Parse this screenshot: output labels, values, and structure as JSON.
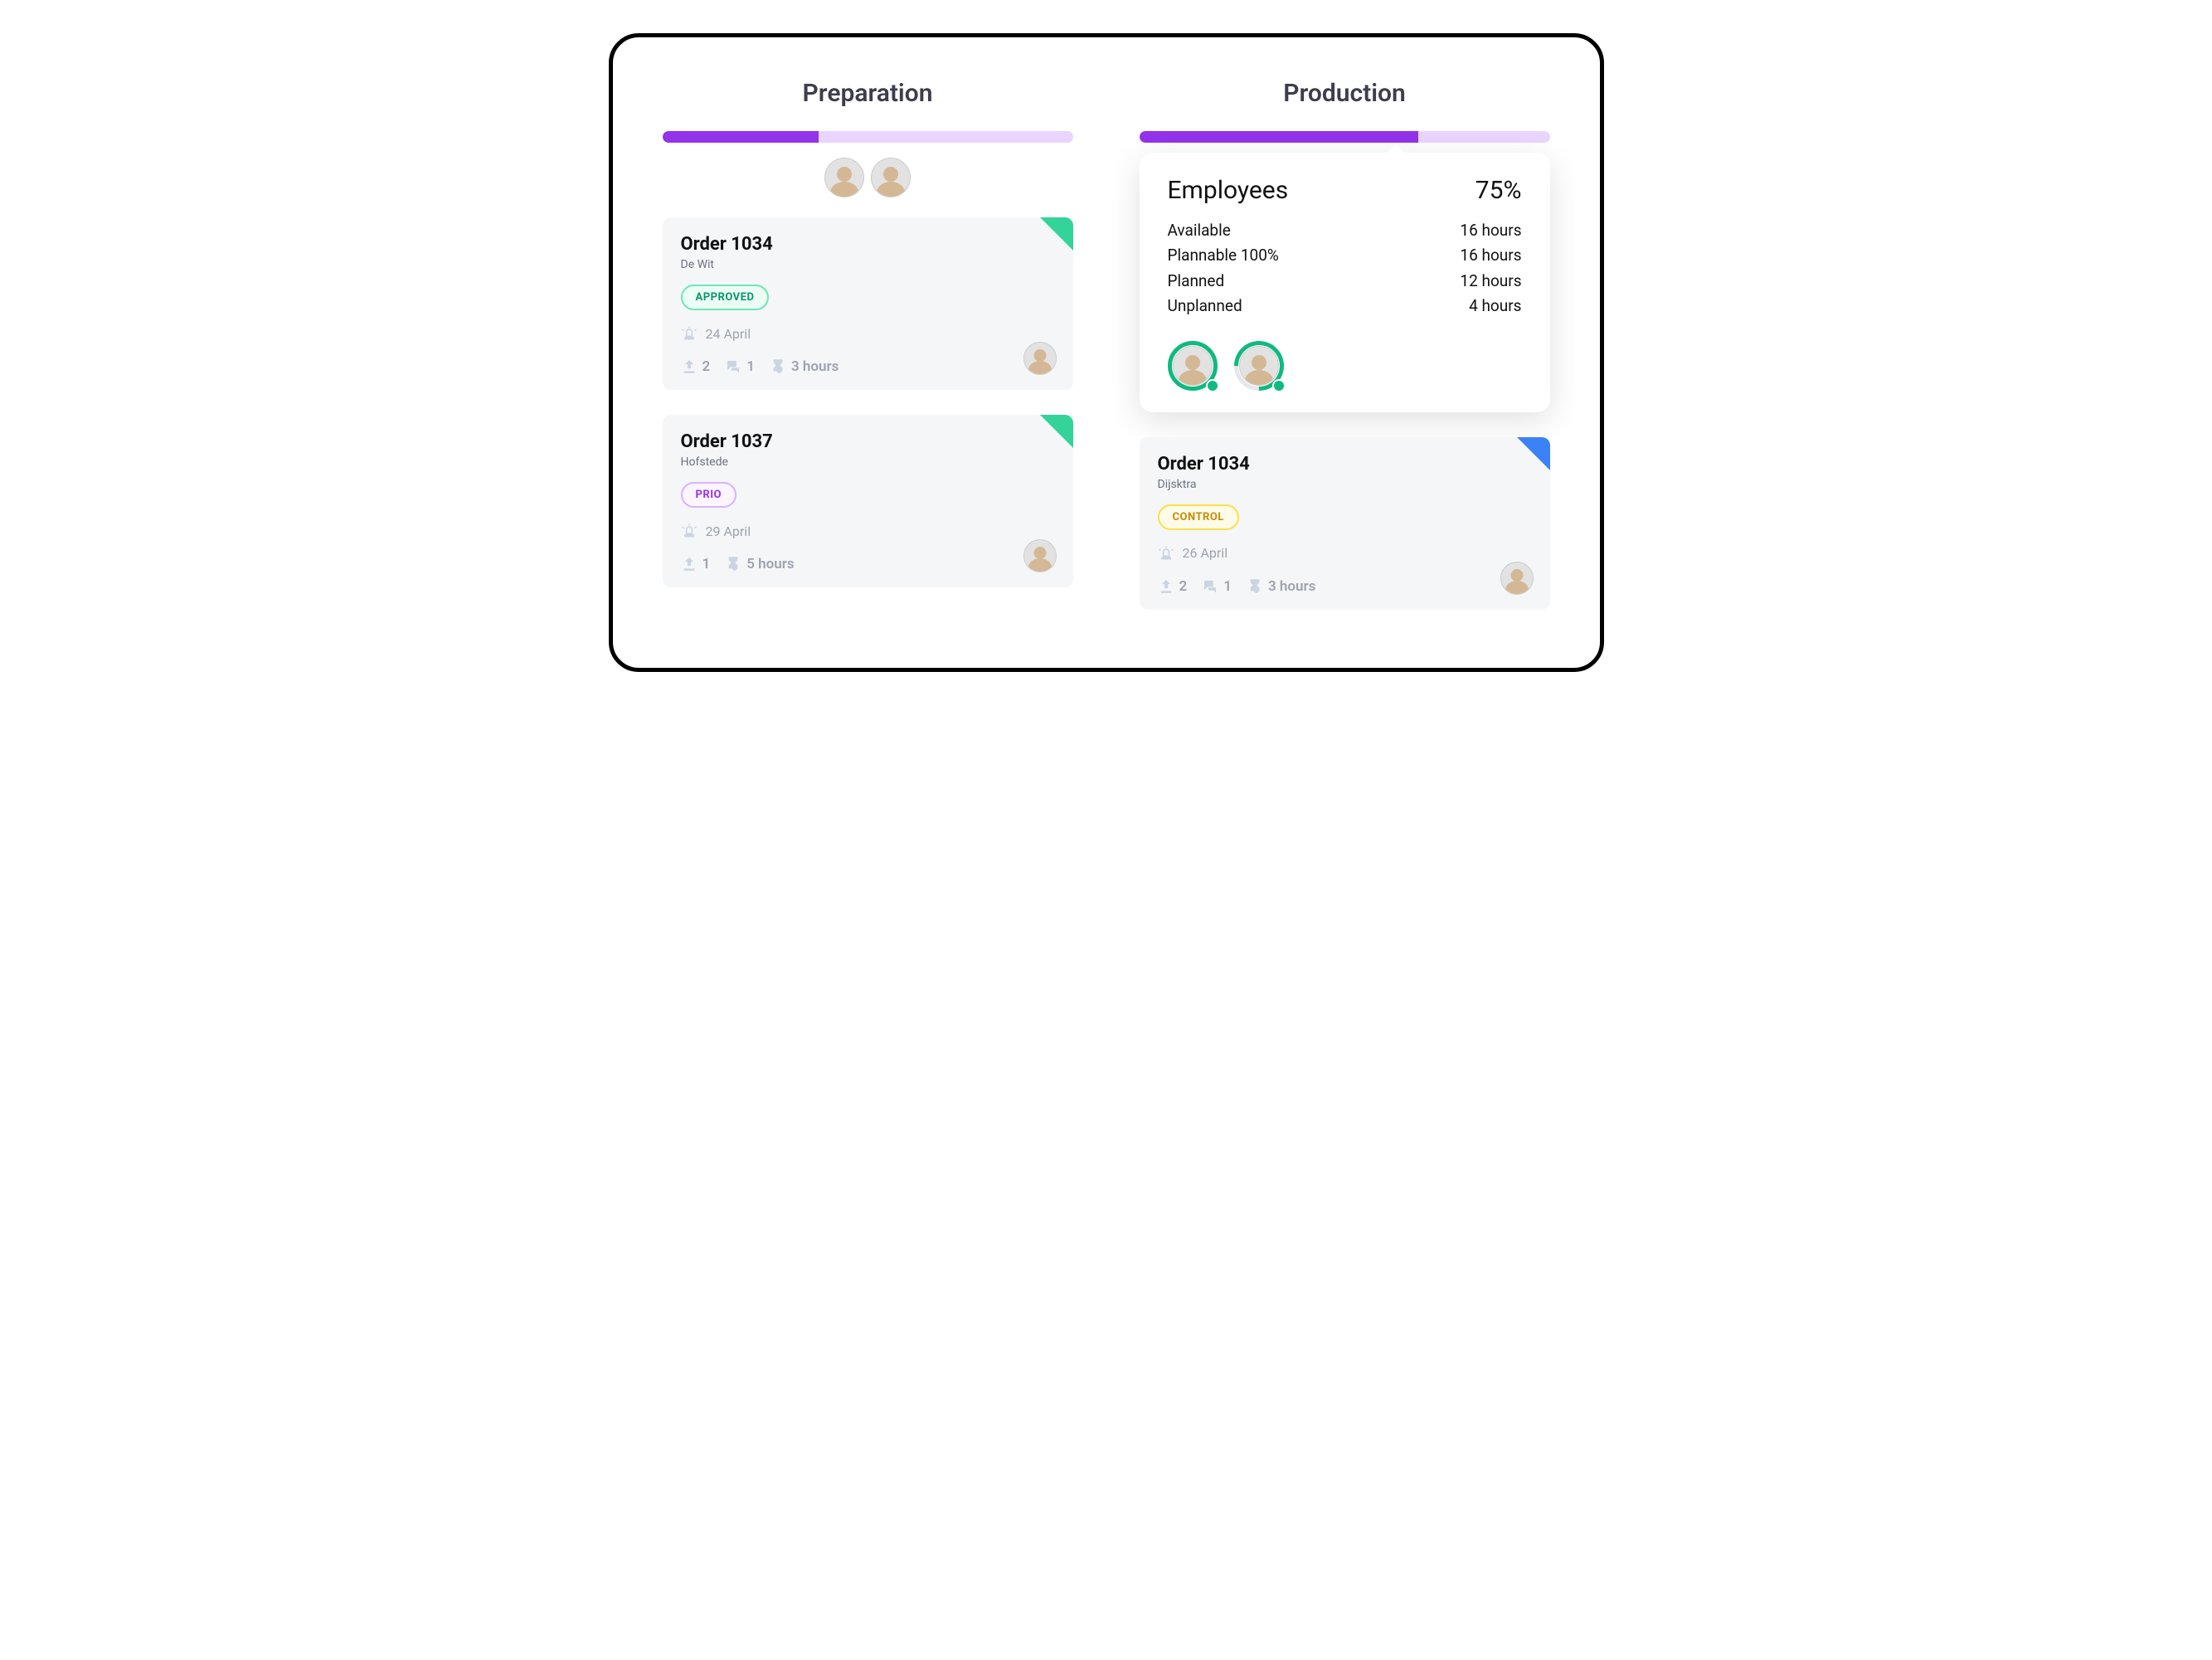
{
  "columns": [
    {
      "title": "Preparation",
      "progress_pct": 38,
      "header_avatars": 2,
      "cards": [
        {
          "title": "Order 1034",
          "customer": "De Wit",
          "tag": {
            "label": "APPROVED",
            "style": "approved"
          },
          "date": "24 April",
          "uploads": "2",
          "comments": "1",
          "duration": "3 hours",
          "corner": "green",
          "assignee_avatar": true
        },
        {
          "title": "Order 1037",
          "customer": "Hofstede",
          "tag": {
            "label": "PRIO",
            "style": "prio"
          },
          "date": "29 April",
          "uploads": "1",
          "comments": null,
          "duration": "5 hours",
          "corner": "green",
          "assignee_avatar": true
        }
      ]
    },
    {
      "title": "Production",
      "progress_pct": 68,
      "popover": {
        "title": "Employees",
        "pct": "75%",
        "rows": [
          {
            "label": "Available",
            "value": "16 hours"
          },
          {
            "label": "Plannable 100%",
            "value": "16 hours"
          },
          {
            "label": "Planned",
            "value": "12 hours"
          },
          {
            "label": "Unplanned",
            "value": "4 hours"
          }
        ],
        "avatars": [
          {
            "ring": "full"
          },
          {
            "ring": "partial"
          }
        ]
      },
      "cards": [
        {
          "title": "Order 1034",
          "customer": "Dijsktra",
          "tag": {
            "label": "CONTROL",
            "style": "control"
          },
          "date": "26 April",
          "uploads": "2",
          "comments": "1",
          "duration": "3 hours",
          "corner": "blue",
          "assignee_avatar": true
        }
      ]
    }
  ]
}
